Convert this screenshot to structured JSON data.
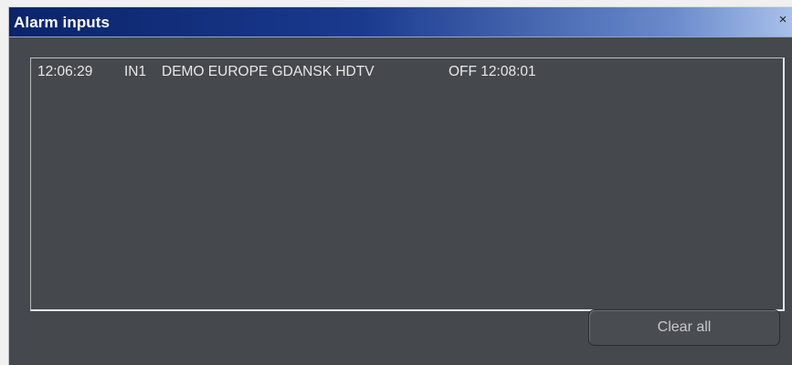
{
  "window": {
    "title": "Alarm inputs",
    "close_glyph": "×",
    "close_icon": "close-icon"
  },
  "alarm_list": {
    "rows": [
      {
        "time": "12:06:29",
        "input": "IN1",
        "name": "DEMO EUROPE GDANSK HDTV",
        "state": "OFF 12:08:01"
      }
    ]
  },
  "buttons": {
    "clear_all_label": "Clear all"
  },
  "colors": {
    "panel_background": "#45484c",
    "title_text": "#ffffff",
    "list_text": "#e8e8e8",
    "button_text": "#c7c9cc"
  }
}
